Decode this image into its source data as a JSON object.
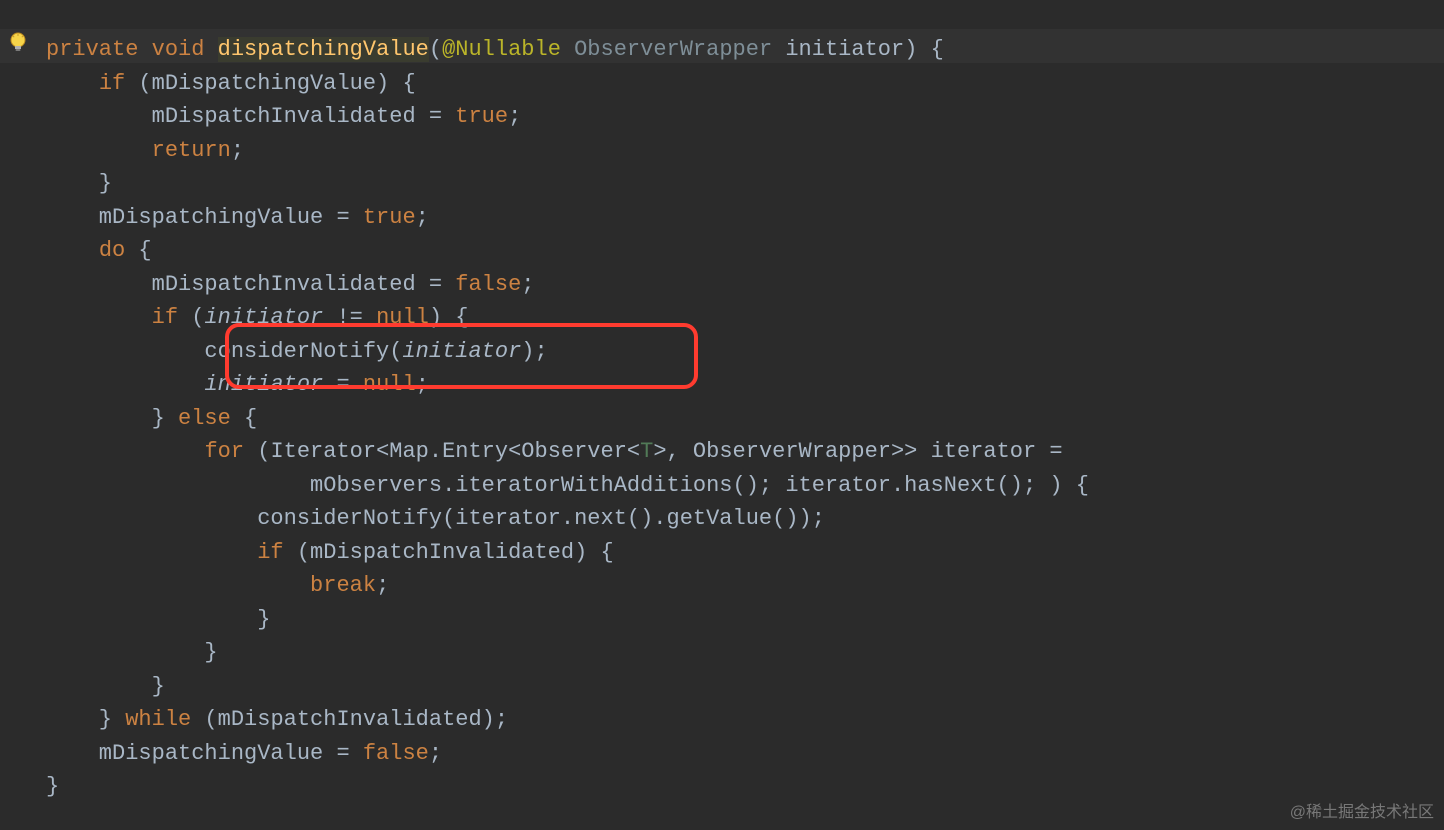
{
  "watermark": "@稀土掘金技术社区",
  "code": {
    "l1_private": "private",
    "l1_void": "void",
    "l1_method": "dispatchingValue",
    "l1_lparen": "(",
    "l1_anno": "@Nullable",
    "l1_type": "ObserverWrapper",
    "l1_param": "initiator",
    "l1_after": ") {",
    "l2_pre": "    ",
    "l2_if": "if",
    "l2_after": " (mDispatchingValue) {",
    "l3": "        mDispatchInvalidated = ",
    "l3_true": "true",
    "l3_end": ";",
    "l4_pre": "        ",
    "l4_return": "return",
    "l4_end": ";",
    "l5": "    }",
    "l6": "    mDispatchingValue = ",
    "l6_true": "true",
    "l6_end": ";",
    "l7_pre": "    ",
    "l7_do": "do",
    "l7_after": " {",
    "l8": "        mDispatchInvalidated = ",
    "l8_false": "false",
    "l8_end": ";",
    "l9_pre": "        ",
    "l9_if": "if",
    "l9_after_a": " (",
    "l9_param": "initiator",
    "l9_after_b": " != ",
    "l9_null": "null",
    "l9_after_c": ") {",
    "l10_pre": "            considerNotify(",
    "l10_param": "initiator",
    "l10_after": ");",
    "l11_pre": "            ",
    "l11_param": "initiator",
    "l11_eq": " = ",
    "l11_null": "null",
    "l11_end": ";",
    "l12_pre": "        } ",
    "l12_else": "else",
    "l12_after": " {",
    "l13_pre": "            ",
    "l13_for": "for",
    "l13_a": " (Iterator<Map.Entry<Observer<",
    "l13_tp": "T",
    "l13_b": ">, ObserverWrapper>> iterator =",
    "l14": "                    mObservers.iteratorWithAdditions(); iterator.hasNext(); ) {",
    "l15": "                considerNotify(iterator.next().getValue());",
    "l16_pre": "                ",
    "l16_if": "if",
    "l16_after": " (mDispatchInvalidated) {",
    "l17_pre": "                    ",
    "l17_break": "break",
    "l17_end": ";",
    "l18": "                }",
    "l19": "            }",
    "l20": "        }",
    "l21_pre": "    } ",
    "l21_while": "while",
    "l21_after": " (mDispatchInvalidated);",
    "l22": "    mDispatchingValue = ",
    "l22_false": "false",
    "l22_end": ";",
    "l23": "}"
  }
}
